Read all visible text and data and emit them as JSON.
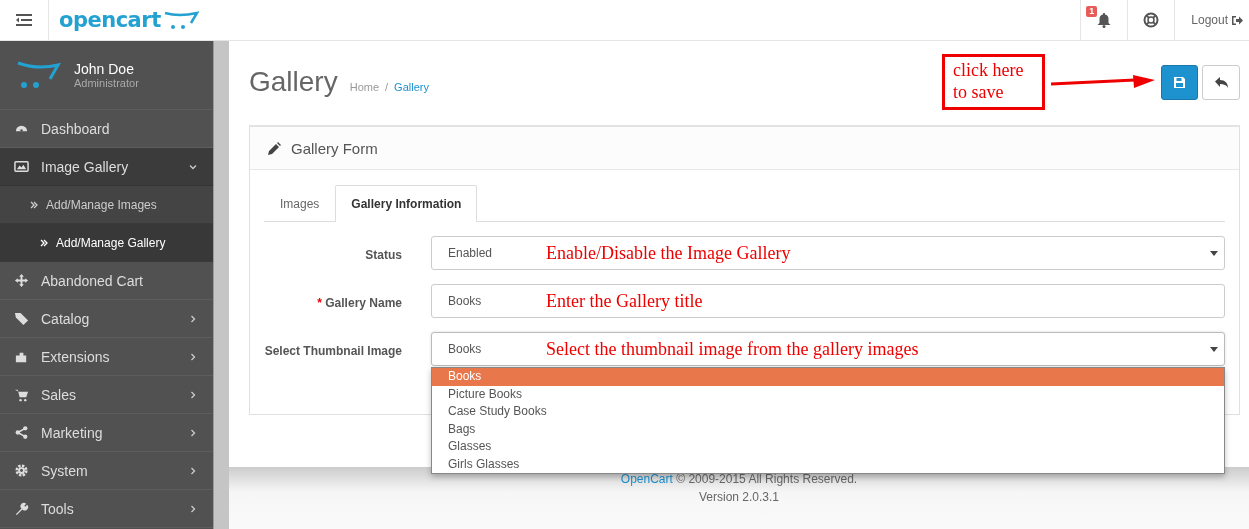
{
  "header": {
    "logo": "opencart",
    "notification_count": "1",
    "logout": "Logout"
  },
  "sidebar": {
    "user": {
      "name": "John Doe",
      "role": "Administrator"
    },
    "items": [
      {
        "label": "Dashboard",
        "has_arrow": false,
        "expanded": false
      },
      {
        "label": "Image Gallery",
        "has_arrow": true,
        "expanded": true,
        "children": [
          {
            "label": "Add/Manage Images",
            "selected": false
          },
          {
            "label": "Add/Manage Gallery",
            "selected": true
          }
        ]
      },
      {
        "label": "Abandoned Cart",
        "has_arrow": false,
        "expanded": false
      },
      {
        "label": "Catalog",
        "has_arrow": true,
        "expanded": false
      },
      {
        "label": "Extensions",
        "has_arrow": true,
        "expanded": false
      },
      {
        "label": "Sales",
        "has_arrow": true,
        "expanded": false
      },
      {
        "label": "Marketing",
        "has_arrow": true,
        "expanded": false
      },
      {
        "label": "System",
        "has_arrow": true,
        "expanded": false
      },
      {
        "label": "Tools",
        "has_arrow": true,
        "expanded": false
      }
    ]
  },
  "page": {
    "title": "Gallery",
    "breadcrumb_separator": "/",
    "breadcrumb": [
      {
        "label": "Home",
        "current": false
      },
      {
        "label": "Gallery",
        "current": true
      }
    ],
    "save_note": "click here to save"
  },
  "panel": {
    "title": "Gallery Form",
    "required_marker": "*",
    "tabs": [
      {
        "label": "Images",
        "selected": false
      },
      {
        "label": "Gallery Information",
        "selected": true
      }
    ],
    "fields": [
      {
        "label": "Status",
        "required": false,
        "kind": "select",
        "value": "Enabled",
        "note": "Enable/Disable the Image Gallery"
      },
      {
        "label": "Gallery Name",
        "required": true,
        "kind": "text",
        "value": "Books",
        "note": "Enter the Gallery title"
      },
      {
        "label": "Select Thumbnail Image",
        "required": false,
        "kind": "select",
        "value": "Books",
        "note": "Select the thumbnail image from the gallery images",
        "open": true,
        "options": [
          {
            "label": "Books",
            "selected": true
          },
          {
            "label": "Picture Books",
            "selected": false
          },
          {
            "label": "Case Study Books",
            "selected": false
          },
          {
            "label": "Bags",
            "selected": false
          },
          {
            "label": "Glasses",
            "selected": false
          },
          {
            "label": "Girls Glasses",
            "selected": false
          }
        ]
      }
    ]
  },
  "footer": {
    "link": "OpenCart",
    "text": "© 2009-2015 All Rights Reserved.",
    "version": "Version 2.0.3.1"
  }
}
